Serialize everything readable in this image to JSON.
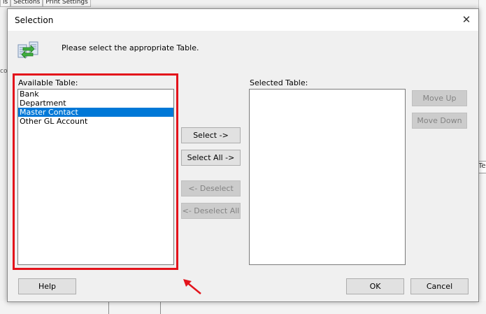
{
  "background": {
    "tabs": [
      "ls",
      "Sections",
      "Print Settings"
    ],
    "right_cell_text": "Tes",
    "left_fragment": "co"
  },
  "dialog": {
    "title": "Selection",
    "close_glyph": "✕",
    "instruction": "Please select the appropriate Table.",
    "available": {
      "label": "Available Table:",
      "items": [
        "Bank",
        "Department",
        "Master Contact",
        "Other GL Account"
      ],
      "selected_index": 2
    },
    "selected": {
      "label": "Selected Table:",
      "items": []
    },
    "buttons": {
      "select": "Select ->",
      "select_all": "Select All ->",
      "deselect": "<- Deselect",
      "deselect_all": "<- Deselect All",
      "move_up": "Move Up",
      "move_down": "Move Down",
      "help": "Help",
      "ok": "OK",
      "cancel": "Cancel"
    }
  },
  "annotation": {
    "highlight_color": "#e3131b"
  },
  "icons": [
    "table-transfer-icon",
    "close-icon",
    "red-arrow-icon"
  ]
}
